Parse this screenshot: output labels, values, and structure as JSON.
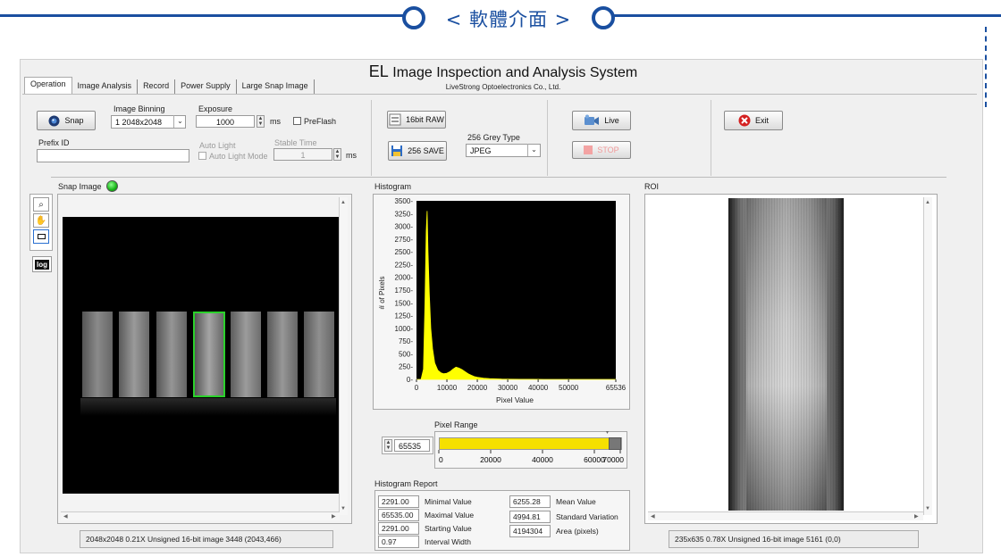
{
  "banner": {
    "title": "< 軟體介面 >"
  },
  "app": {
    "title_prefix": "EL",
    "title_rest": "Image Inspection and Analysis System",
    "subtitle": "LiveStrong Optoelectronics Co., Ltd."
  },
  "tabs": [
    "Operation",
    "Image Analysis",
    "Record",
    "Power Supply",
    "Large Snap Image"
  ],
  "controls": {
    "snap_label": "Snap",
    "binning_label": "Image Binning",
    "binning_value": "1 2048x2048",
    "exposure_label": "Exposure",
    "exposure_value": "1000",
    "exposure_unit": "ms",
    "preflash_label": "PreFlash",
    "prefix_label": "Prefix ID",
    "prefix_value": "",
    "autolight_label": "Auto Light",
    "autolight_mode_label": "Auto Light Mode",
    "stable_label": "Stable Time",
    "stable_value": "1",
    "stable_unit": "ms",
    "raw_label": "16bit RAW",
    "save_label": "256 SAVE",
    "grey_label": "256 Grey Type",
    "grey_value": "JPEG",
    "live_label": "Live",
    "stop_label": "STOP",
    "exit_label": "Exit"
  },
  "snap": {
    "label": "Snap Image",
    "log_label": "log",
    "status": "2048x2048 0.21X Unsigned 16-bit image 3448    (2043,466)"
  },
  "histogram": {
    "label": "Histogram",
    "chart_data": {
      "type": "area",
      "xlabel": "Pixel Value",
      "ylabel": "# of Pixels",
      "xlim": [
        0,
        65536
      ],
      "ylim": [
        0,
        3500
      ],
      "x_ticks": [
        "0",
        "10000",
        "20000",
        "30000",
        "40000",
        "50000",
        "65536"
      ],
      "y_ticks": [
        "0",
        "250",
        "500",
        "750",
        "1000",
        "1250",
        "1500",
        "1750",
        "2000",
        "2250",
        "2500",
        "2750",
        "3000",
        "3250",
        "3500"
      ],
      "x": [
        0,
        1500,
        2291,
        2800,
        3200,
        3500,
        3800,
        4200,
        4700,
        5300,
        6000,
        7000,
        8000,
        9000,
        10000,
        11000,
        12000,
        13000,
        14000,
        15000,
        16000,
        17000,
        18000,
        19000,
        20000,
        22000,
        24000,
        26000,
        28000,
        30000,
        34000,
        38000,
        42000,
        50000,
        60000,
        65535
      ],
      "values": [
        0,
        0,
        200,
        1500,
        2900,
        3300,
        2500,
        1700,
        1000,
        600,
        320,
        180,
        130,
        110,
        120,
        150,
        200,
        240,
        220,
        190,
        150,
        110,
        80,
        55,
        40,
        25,
        15,
        10,
        6,
        4,
        2,
        1,
        0,
        0,
        0,
        0
      ],
      "color": "#ffff00"
    }
  },
  "pixel_range": {
    "label": "Pixel Range",
    "value": "65535",
    "fill_fraction": 0.945,
    "ticks": [
      "0",
      "20000",
      "40000",
      "60000",
      "70000"
    ],
    "color": "#f5e000"
  },
  "report": {
    "label": "Histogram Report",
    "rows": [
      {
        "value": "2291.00",
        "name": "Minimal Value"
      },
      {
        "value": "65535.00",
        "name": "Maximal Value"
      },
      {
        "value": "2291.00",
        "name": "Starting Value"
      },
      {
        "value": "0.97",
        "name": "Interval Width"
      }
    ],
    "rows2": [
      {
        "value": "6255.28",
        "name": "Mean Value"
      },
      {
        "value": "4994.81",
        "name": "Standard  Variation"
      },
      {
        "value": "4194304",
        "name": "Area (pixels)"
      }
    ]
  },
  "roi": {
    "label": "ROI",
    "status": "235x635 0.78X Unsigned 16-bit image 5161    (0,0)"
  }
}
